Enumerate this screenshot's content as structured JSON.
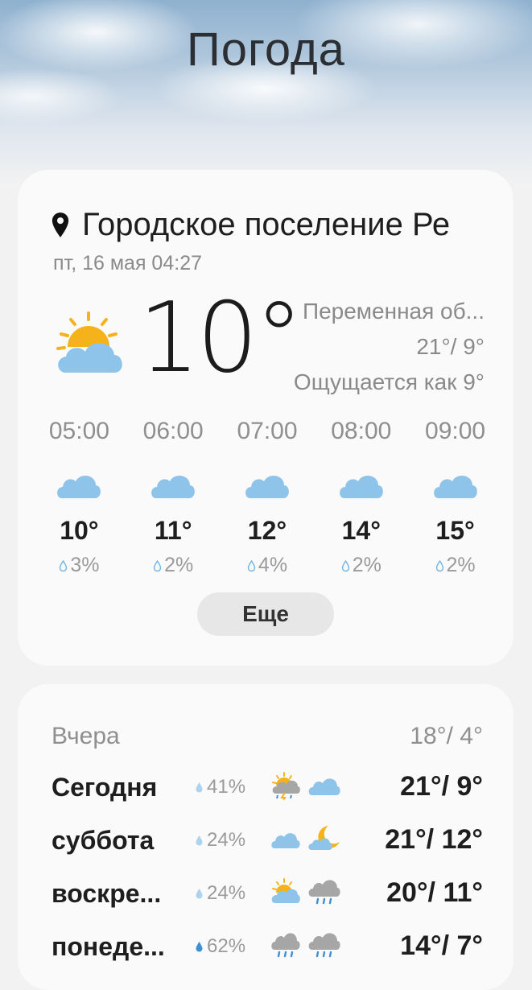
{
  "app": {
    "title": "Погода"
  },
  "current": {
    "location": "Городское поселение Ре",
    "datetime": "пт, 16 мая 04:27",
    "temperature": "10°",
    "condition": "Переменная об...",
    "minmax": "21°/ 9°",
    "feels_like": "Ощущается как 9°",
    "icon": "partly-cloudy-icon"
  },
  "hourly": [
    {
      "time": "05:00",
      "temp": "10°",
      "precip": "3%",
      "icon": "cloud-icon"
    },
    {
      "time": "06:00",
      "temp": "11°",
      "precip": "2%",
      "icon": "cloud-icon"
    },
    {
      "time": "07:00",
      "temp": "12°",
      "precip": "4%",
      "icon": "cloud-icon"
    },
    {
      "time": "08:00",
      "temp": "14°",
      "precip": "2%",
      "icon": "cloud-icon"
    },
    {
      "time": "09:00",
      "temp": "15°",
      "precip": "2%",
      "icon": "cloud-icon"
    }
  ],
  "more_button": "Еще",
  "daily": {
    "yesterday": {
      "label": "Вчера",
      "range": "18°/ 4°"
    },
    "days": [
      {
        "day": "Сегодня",
        "precip": "41%",
        "icon_day": "thunderstorm-sun-icon",
        "icon_night": "cloud-icon",
        "range": "21°/ 9°"
      },
      {
        "day": "суббота",
        "precip": "24%",
        "icon_day": "cloud-icon",
        "icon_night": "moon-cloud-icon",
        "range": "21°/ 12°"
      },
      {
        "day": "воскре...",
        "precip": "24%",
        "icon_day": "partly-cloudy-icon",
        "icon_night": "rain-cloud-icon",
        "range": "20°/ 11°"
      },
      {
        "day": "понеде...",
        "precip": "62%",
        "icon_day": "rain-cloud-icon",
        "icon_night": "rain-cloud-icon",
        "range": "14°/ 7°"
      }
    ]
  },
  "colors": {
    "cloud": "#8fc4ea",
    "sun": "#f6b21b",
    "drop": "#6fb3e4",
    "moon": "#f6b21b"
  }
}
